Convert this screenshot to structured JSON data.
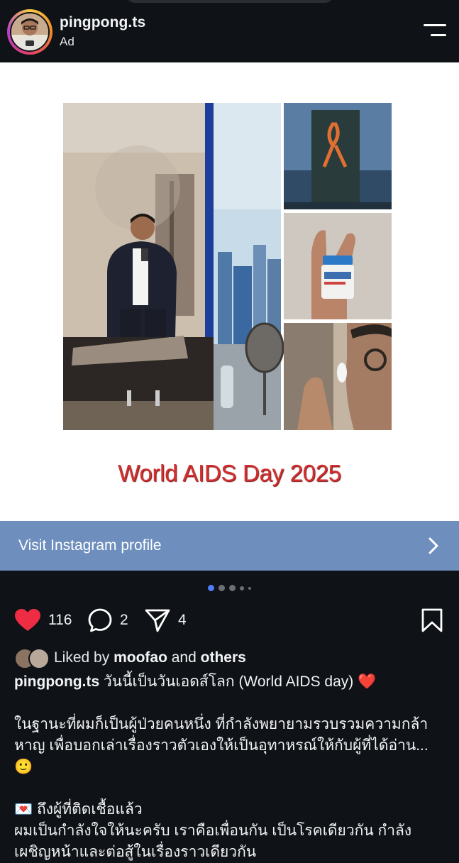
{
  "post": {
    "username": "pingpong.ts",
    "sponsored_label": "Ad"
  },
  "media": {
    "title": "World AIDS Day 2025",
    "carousel_total": 5,
    "carousel_active": 1
  },
  "cta": {
    "label": "Visit Instagram profile"
  },
  "actions": {
    "likes": "116",
    "comments": "2",
    "shares": "4"
  },
  "liked_by": {
    "prefix": "Liked by",
    "user": "moofao",
    "and": "and",
    "others": "others"
  },
  "caption": {
    "username": "pingpong.ts",
    "line1": "วันนี้เป็นวันเอดส์โลก (World AIDS day) ❤️",
    "para1": "ในฐานะที่ผมก็เป็นผู้ป่วยคนหนึ่ง ที่กำลังพยายามรวบรวมความกล้าหาญ เพื่อบอกเล่าเรื่องราวตัวเองให้เป็นอุทาหรณ์ให้กับผู้ที่ได้อ่าน... 🙂",
    "heading": "💌 ถึงผู้ที่ติดเชื้อแล้ว",
    "para2": "ผมเป็นกำลังใจให้นะครับ เราคือเพื่อนกัน เป็นโรคเดียวกัน กำลังเผชิญหน้าและต่อสู้ในเรื่องราวเดียวกัน"
  },
  "colors": {
    "background": "#0f1216",
    "cta_bar": "#6e8fbd",
    "like_red": "#ee2d45",
    "title_red": "#d23030",
    "dot_active": "#4f7cf7"
  },
  "icons": [
    "menu-icon",
    "heart-icon",
    "comment-icon",
    "share-icon",
    "bookmark-icon",
    "chevron-right-icon"
  ]
}
